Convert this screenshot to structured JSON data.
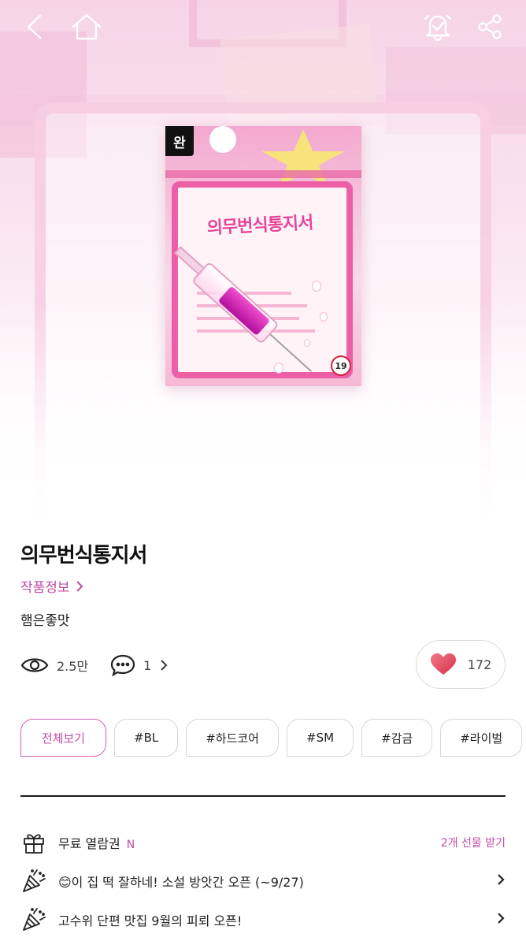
{
  "header": {
    "back_icon": "back-arrow-icon",
    "home_icon": "home-icon",
    "notify_icon": "bell-check-icon",
    "share_icon": "share-icon"
  },
  "cover": {
    "completed_badge": "완",
    "cover_title": "의무번식통지서",
    "age_rating": "19"
  },
  "work": {
    "title": "의무번식통지서",
    "info_link": "작품정보",
    "author": "햄은좋맛"
  },
  "stats": {
    "views": "2.5만",
    "comments": "1",
    "likes": "172"
  },
  "tags": [
    "전체보기",
    "#BL",
    "#하드코어",
    "#SM",
    "#감금",
    "#라이벌"
  ],
  "events": [
    {
      "icon": "gift-icon",
      "text": "무료 열람권",
      "badge": "N",
      "action": "2개 선물 받기"
    },
    {
      "icon": "party-popper-icon",
      "text": "😊이 집 떡 잘하네! 소설 방앗간 오픈 (~9/27)"
    },
    {
      "icon": "party-popper-icon",
      "text": "고수위 단편 맛집 9월의 피뢰 오픈!"
    }
  ],
  "colors": {
    "accent": "#c54aa3",
    "heart": "#e8475f",
    "divider": "#1a1a1a"
  }
}
